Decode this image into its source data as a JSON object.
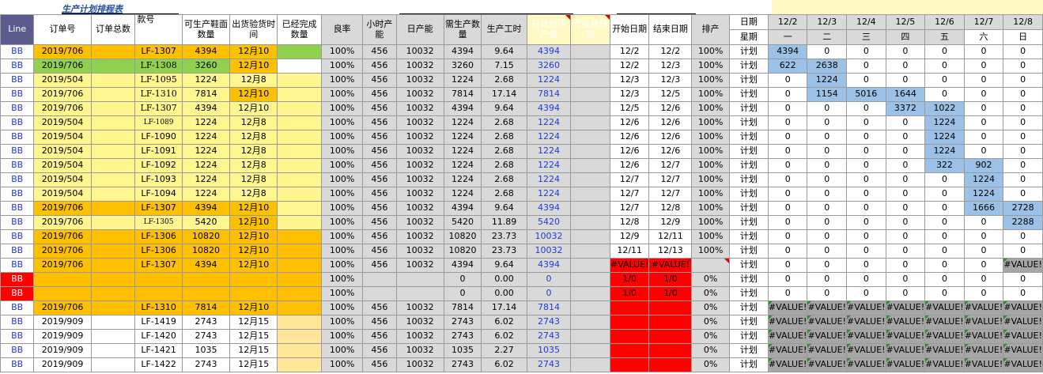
{
  "sheet_title": "生产计划排程表",
  "colors": {
    "orange": "#ffc000",
    "yellow": "#fff68f",
    "green": "#92d050",
    "gray": "#d9d9d9",
    "red": "#ff0000",
    "blue_fill": "#9bc2e6",
    "header_line": "#5b5b8e"
  },
  "headers": {
    "line": "Line",
    "order_no": "订单号",
    "order_total": "订单总数",
    "style_no": "款号",
    "producible_qty": "可生产鞋面数量",
    "ship_time": "出货验货时间",
    "completed_qty": "已经完成数量",
    "yield": "良率",
    "hourly_capacity": "小时产能",
    "daily_capacity": "日产能",
    "required_qty": "需生产数量",
    "prod_hours": "生产工时",
    "daily_plan_qty": "日计划排产量",
    "release_date": "可投放日期",
    "start_date": "开始日期",
    "end_date": "结束日期",
    "scheduling": "排产",
    "date_label": "日期",
    "weekday_label": "星期"
  },
  "dates": [
    "12/2",
    "12/3",
    "12/4",
    "12/5",
    "12/6",
    "12/7",
    "12/8"
  ],
  "weekdays": [
    "一",
    "二",
    "三",
    "四",
    "五",
    "六",
    "日"
  ],
  "rows": [
    {
      "line": "BB",
      "order": "2019/706",
      "style": "LF-1307",
      "qty": "4394",
      "ship": "12月10",
      "yield": "100%",
      "hourly": "456",
      "daily": "10032",
      "req": "4394",
      "hours": "9.64",
      "plan": "4394",
      "start": "12/2",
      "end": "12/2",
      "sched": "100%",
      "type": "计划",
      "days": [
        "4394",
        "0",
        "0",
        "0",
        "0",
        "0",
        "0"
      ]
    },
    {
      "line": "BB",
      "order": "2019/706",
      "style": "LF-1308",
      "qty": "3260",
      "ship": "12月10",
      "yield": "100%",
      "hourly": "456",
      "daily": "10032",
      "req": "3260",
      "hours": "7.15",
      "plan": "3260",
      "start": "12/2",
      "end": "12/3",
      "sched": "100%",
      "type": "计划",
      "days": [
        "622",
        "2638",
        "0",
        "0",
        "0",
        "0",
        "0"
      ]
    },
    {
      "line": "BB",
      "order": "2019/504",
      "style": "LF-1095",
      "qty": "1224",
      "ship": "12月8",
      "yield": "100%",
      "hourly": "456",
      "daily": "10032",
      "req": "1224",
      "hours": "2.68",
      "plan": "1224",
      "start": "12/3",
      "end": "12/3",
      "sched": "100%",
      "type": "计划",
      "days": [
        "0",
        "1224",
        "0",
        "0",
        "0",
        "0",
        "0"
      ]
    },
    {
      "line": "BB",
      "order": "2019/706",
      "style": "LF-1310",
      "qty": "7814",
      "ship": "12月10",
      "yield": "100%",
      "hourly": "456",
      "daily": "10032",
      "req": "7814",
      "hours": "17.14",
      "plan": "7814",
      "start": "12/3",
      "end": "12/5",
      "sched": "100%",
      "type": "计划",
      "days": [
        "0",
        "1154",
        "5016",
        "1644",
        "0",
        "0",
        "0"
      ]
    },
    {
      "line": "BB",
      "order": "2019/706",
      "style": "LF-1307",
      "qty": "4394",
      "ship": "12月10",
      "yield": "100%",
      "hourly": "456",
      "daily": "10032",
      "req": "4394",
      "hours": "9.64",
      "plan": "4394",
      "start": "12/5",
      "end": "12/6",
      "sched": "100%",
      "type": "计划",
      "days": [
        "0",
        "0",
        "0",
        "3372",
        "1022",
        "0",
        "0"
      ]
    },
    {
      "line": "BB",
      "order": "2019/504",
      "style": "LF-1089",
      "qty": "1224",
      "ship": "12月8",
      "yield": "100%",
      "hourly": "456",
      "daily": "10032",
      "req": "1224",
      "hours": "2.68",
      "plan": "1224",
      "start": "12/6",
      "end": "12/6",
      "sched": "100%",
      "type": "计划",
      "days": [
        "0",
        "0",
        "0",
        "0",
        "1224",
        "0",
        "0"
      ]
    },
    {
      "line": "BB",
      "order": "2019/504",
      "style": "LF-1090",
      "qty": "1224",
      "ship": "12月8",
      "yield": "100%",
      "hourly": "456",
      "daily": "10032",
      "req": "1224",
      "hours": "2.68",
      "plan": "1224",
      "start": "12/6",
      "end": "12/6",
      "sched": "100%",
      "type": "计划",
      "days": [
        "0",
        "0",
        "0",
        "0",
        "1224",
        "0",
        "0"
      ]
    },
    {
      "line": "BB",
      "order": "2019/504",
      "style": "LF-1091",
      "qty": "1224",
      "ship": "12月8",
      "yield": "100%",
      "hourly": "456",
      "daily": "10032",
      "req": "1224",
      "hours": "2.68",
      "plan": "1224",
      "start": "12/6",
      "end": "12/6",
      "sched": "100%",
      "type": "计划",
      "days": [
        "0",
        "0",
        "0",
        "0",
        "1224",
        "0",
        "0"
      ]
    },
    {
      "line": "BB",
      "order": "2019/504",
      "style": "LF-1092",
      "qty": "1224",
      "ship": "12月8",
      "yield": "100%",
      "hourly": "456",
      "daily": "10032",
      "req": "1224",
      "hours": "2.68",
      "plan": "1224",
      "start": "12/6",
      "end": "12/7",
      "sched": "100%",
      "type": "计划",
      "days": [
        "0",
        "0",
        "0",
        "0",
        "322",
        "902",
        "0"
      ]
    },
    {
      "line": "BB",
      "order": "2019/504",
      "style": "LF-1093",
      "qty": "1224",
      "ship": "12月8",
      "yield": "100%",
      "hourly": "456",
      "daily": "10032",
      "req": "1224",
      "hours": "2.68",
      "plan": "1224",
      "start": "12/7",
      "end": "12/7",
      "sched": "100%",
      "type": "计划",
      "days": [
        "0",
        "0",
        "0",
        "0",
        "0",
        "1224",
        "0"
      ]
    },
    {
      "line": "BB",
      "order": "2019/504",
      "style": "LF-1094",
      "qty": "1224",
      "ship": "12月8",
      "yield": "100%",
      "hourly": "456",
      "daily": "10032",
      "req": "1224",
      "hours": "2.68",
      "plan": "1224",
      "start": "12/7",
      "end": "12/7",
      "sched": "100%",
      "type": "计划",
      "days": [
        "0",
        "0",
        "0",
        "0",
        "0",
        "1224",
        "0"
      ]
    },
    {
      "line": "BB",
      "order": "2019/706",
      "style": "LF-1307",
      "qty": "4394",
      "ship": "12月10",
      "yield": "100%",
      "hourly": "456",
      "daily": "10032",
      "req": "4394",
      "hours": "9.64",
      "plan": "4394",
      "start": "12/7",
      "end": "12/8",
      "sched": "100%",
      "type": "计划",
      "days": [
        "0",
        "0",
        "0",
        "0",
        "0",
        "1666",
        "2728"
      ]
    },
    {
      "line": "BB",
      "order": "2019/706",
      "style": "LF-1305",
      "qty": "5420",
      "ship": "12月10",
      "yield": "100%",
      "hourly": "456",
      "daily": "10032",
      "req": "5420",
      "hours": "11.89",
      "plan": "5420",
      "start": "12/8",
      "end": "12/9",
      "sched": "100%",
      "type": "计划",
      "days": [
        "0",
        "0",
        "0",
        "0",
        "0",
        "0",
        "2288"
      ]
    },
    {
      "line": "BB",
      "order": "2019/706",
      "style": "LF-1306",
      "qty": "10820",
      "ship": "12月10",
      "yield": "100%",
      "hourly": "456",
      "daily": "10032",
      "req": "10820",
      "hours": "23.73",
      "plan": "10032",
      "start": "12/9",
      "end": "12/11",
      "sched": "100%",
      "type": "计划",
      "days": [
        "0",
        "0",
        "0",
        "0",
        "0",
        "0",
        "0"
      ]
    },
    {
      "line": "BB",
      "order": "2019/706",
      "style": "LF-1306",
      "qty": "10820",
      "ship": "12月10",
      "yield": "100%",
      "hourly": "456",
      "daily": "10032",
      "req": "10820",
      "hours": "23.73",
      "plan": "10032",
      "start": "12/11",
      "end": "12/13",
      "sched": "100%",
      "type": "计划",
      "days": [
        "0",
        "0",
        "0",
        "0",
        "0",
        "0",
        "0"
      ]
    },
    {
      "line": "BB",
      "order": "2019/706",
      "style": "LF-1307",
      "qty": "4394",
      "ship": "12月10",
      "yield": "100%",
      "hourly": "456",
      "daily": "10032",
      "req": "4394",
      "hours": "9.64",
      "plan": "4394",
      "start": "#VALUE!",
      "end": "#VALUE!",
      "sched": "",
      "type": "计划",
      "days": [
        "0",
        "0",
        "0",
        "0",
        "0",
        "0",
        "#VALUE!"
      ]
    },
    {
      "line": "BB",
      "order": "",
      "style": "",
      "qty": "",
      "ship": "",
      "yield": "100%",
      "hourly": "",
      "daily": "",
      "req": "0",
      "hours": "0.00",
      "plan": "0",
      "start": "1/0",
      "end": "1/0",
      "sched": "0%",
      "type": "计划",
      "days": [
        "0",
        "0",
        "0",
        "0",
        "0",
        "0",
        "0"
      ]
    },
    {
      "line": "BB",
      "order": "",
      "style": "",
      "qty": "",
      "ship": "",
      "yield": "100%",
      "hourly": "",
      "daily": "",
      "req": "0",
      "hours": "0.00",
      "plan": "0",
      "start": "1/0",
      "end": "1/0",
      "sched": "0%",
      "type": "计划",
      "days": [
        "0",
        "0",
        "0",
        "0",
        "0",
        "0",
        "0"
      ]
    },
    {
      "line": "BB",
      "order": "2019/706",
      "style": "LF-1310",
      "qty": "7814",
      "ship": "12月10",
      "yield": "100%",
      "hourly": "456",
      "daily": "10032",
      "req": "7814",
      "hours": "17.14",
      "plan": "7814",
      "start": "",
      "end": "",
      "sched": "0%",
      "type": "计划",
      "days": [
        "#VALUE!",
        "#VALUE!",
        "#VALUE!",
        "#VALUE!",
        "#VALUE!",
        "#VALUE!",
        "#VALUE!"
      ]
    },
    {
      "line": "BB",
      "order": "2019/909",
      "style": "LF-1419",
      "qty": "2743",
      "ship": "12月15",
      "yield": "100%",
      "hourly": "456",
      "daily": "10032",
      "req": "2743",
      "hours": "6.02",
      "plan": "2743",
      "start": "",
      "end": "",
      "sched": "0%",
      "type": "计划",
      "days": [
        "#VALUE!",
        "#VALUE!",
        "#VALUE!",
        "#VALUE!",
        "#VALUE!",
        "#VALUE!",
        "#VALUE!"
      ]
    },
    {
      "line": "BB",
      "order": "2019/909",
      "style": "LF-1420",
      "qty": "2743",
      "ship": "12月15",
      "yield": "100%",
      "hourly": "456",
      "daily": "10032",
      "req": "2743",
      "hours": "6.02",
      "plan": "2743",
      "start": "",
      "end": "",
      "sched": "0%",
      "type": "计划",
      "days": [
        "#VALUE!",
        "#VALUE!",
        "#VALUE!",
        "#VALUE!",
        "#VALUE!",
        "#VALUE!",
        "#VALUE!"
      ]
    },
    {
      "line": "BB",
      "order": "2019/909",
      "style": "LF-1421",
      "qty": "1035",
      "ship": "12月15",
      "yield": "100%",
      "hourly": "456",
      "daily": "10032",
      "req": "1035",
      "hours": "2.27",
      "plan": "1035",
      "start": "",
      "end": "",
      "sched": "0%",
      "type": "计划",
      "days": [
        "#VALUE!",
        "#VALUE!",
        "#VALUE!",
        "#VALUE!",
        "#VALUE!",
        "#VALUE!",
        "#VALUE!"
      ]
    },
    {
      "line": "BB",
      "order": "2019/909",
      "style": "LF-1422",
      "qty": "2743",
      "ship": "12月15",
      "yield": "100%",
      "hourly": "456",
      "daily": "10032",
      "req": "2743",
      "hours": "6.02",
      "plan": "2743",
      "start": "",
      "end": "",
      "sched": "0%",
      "type": "计划",
      "days": [
        "#VALUE!",
        "#VALUE!",
        "#VALUE!",
        "#VALUE!",
        "#VALUE!",
        "#VALUE!",
        "#VALUE!"
      ]
    }
  ]
}
